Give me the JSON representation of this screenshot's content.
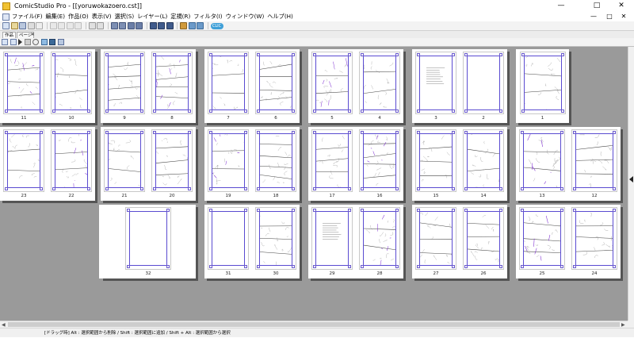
{
  "window": {
    "title": "ComicStudio Pro - [[yoruwokazoero.cst]]",
    "controls": {
      "minimize": "—",
      "maximize": "□",
      "close": "✕"
    },
    "doc_controls": {
      "minimize": "—",
      "restore": "□",
      "close": "✕"
    }
  },
  "menu": {
    "items": [
      "ファイル(F)",
      "編集(E)",
      "作品(O)",
      "表示(V)",
      "選択(S)",
      "レイヤー(L)",
      "定規(R)",
      "フィルタ(I)",
      "ウィンドウ(W)",
      "ヘルプ(H)"
    ]
  },
  "toolbar": {
    "badge_label": "CLIC"
  },
  "tabs": {
    "works": "作品",
    "page": "ページ",
    "close": "✕"
  },
  "pages": {
    "row1": [
      "11",
      "10",
      "9",
      "8",
      "7",
      "6",
      "5",
      "4",
      "3",
      "2",
      "1"
    ],
    "row2": [
      "23",
      "22",
      "21",
      "20",
      "19",
      "18",
      "17",
      "16",
      "15",
      "14",
      "13",
      "12"
    ],
    "row3": [
      "32",
      "31",
      "30",
      "29",
      "28",
      "27",
      "26",
      "25",
      "24"
    ]
  },
  "status": {
    "text": "[ドラッグ時] Alt : 選択範囲から削除 / Shift : 選択範囲に追加 / Shift + Alt : 選択範囲から選択"
  },
  "colors": {
    "canvas_bg": "#9a9a9a",
    "frame": "#5a4bd1",
    "accent_badge": "#3fa0d8"
  }
}
